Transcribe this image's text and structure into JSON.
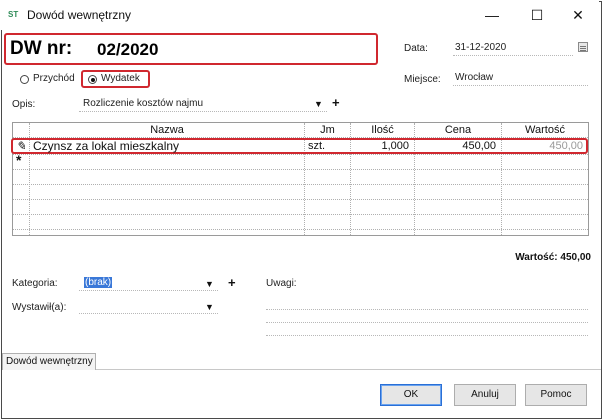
{
  "window": {
    "title": "Dowód wewnętrzny",
    "app_icon_text": "ST",
    "minimize_glyph": "—",
    "maximize_glyph": "☐",
    "close_glyph": "✕"
  },
  "header": {
    "doc_label": "DW nr:",
    "doc_number": "02/2020",
    "date_label": "Data:",
    "date_value": "31-12-2020",
    "place_label": "Miejsce:",
    "place_value": "Wrocław"
  },
  "type_options": [
    {
      "label": "Przychód",
      "selected": false
    },
    {
      "label": "Wydatek",
      "selected": true
    }
  ],
  "description": {
    "label": "Opis:",
    "value": "Rozliczenie kosztów najmu"
  },
  "table": {
    "columns": [
      "Nazwa",
      "Jm",
      "Ilość",
      "Cena",
      "Wartość"
    ],
    "rows": [
      {
        "name": "Czynsz za lokal mieszkalny",
        "unit": "szt.",
        "qty": "1,000",
        "price": "450,00",
        "value": "450,00"
      }
    ],
    "edit_marker": "✎",
    "new_row_marker": "*"
  },
  "total": {
    "text": "Wartość: 450,00"
  },
  "category": {
    "label": "Kategoria:",
    "value": "(brak)"
  },
  "issuer": {
    "label": "Wystawił(a):",
    "value": ""
  },
  "notes": {
    "label": "Uwagi:"
  },
  "dropdown_glyph": "▼",
  "add_glyph": "+",
  "tab": {
    "label": "Dowód wewnętrzny"
  },
  "buttons": {
    "ok": "OK",
    "cancel": "Anuluj",
    "help": "Pomoc"
  },
  "colors": {
    "highlight_border": "#d0282f",
    "selection_bg": "#3a78d8"
  }
}
